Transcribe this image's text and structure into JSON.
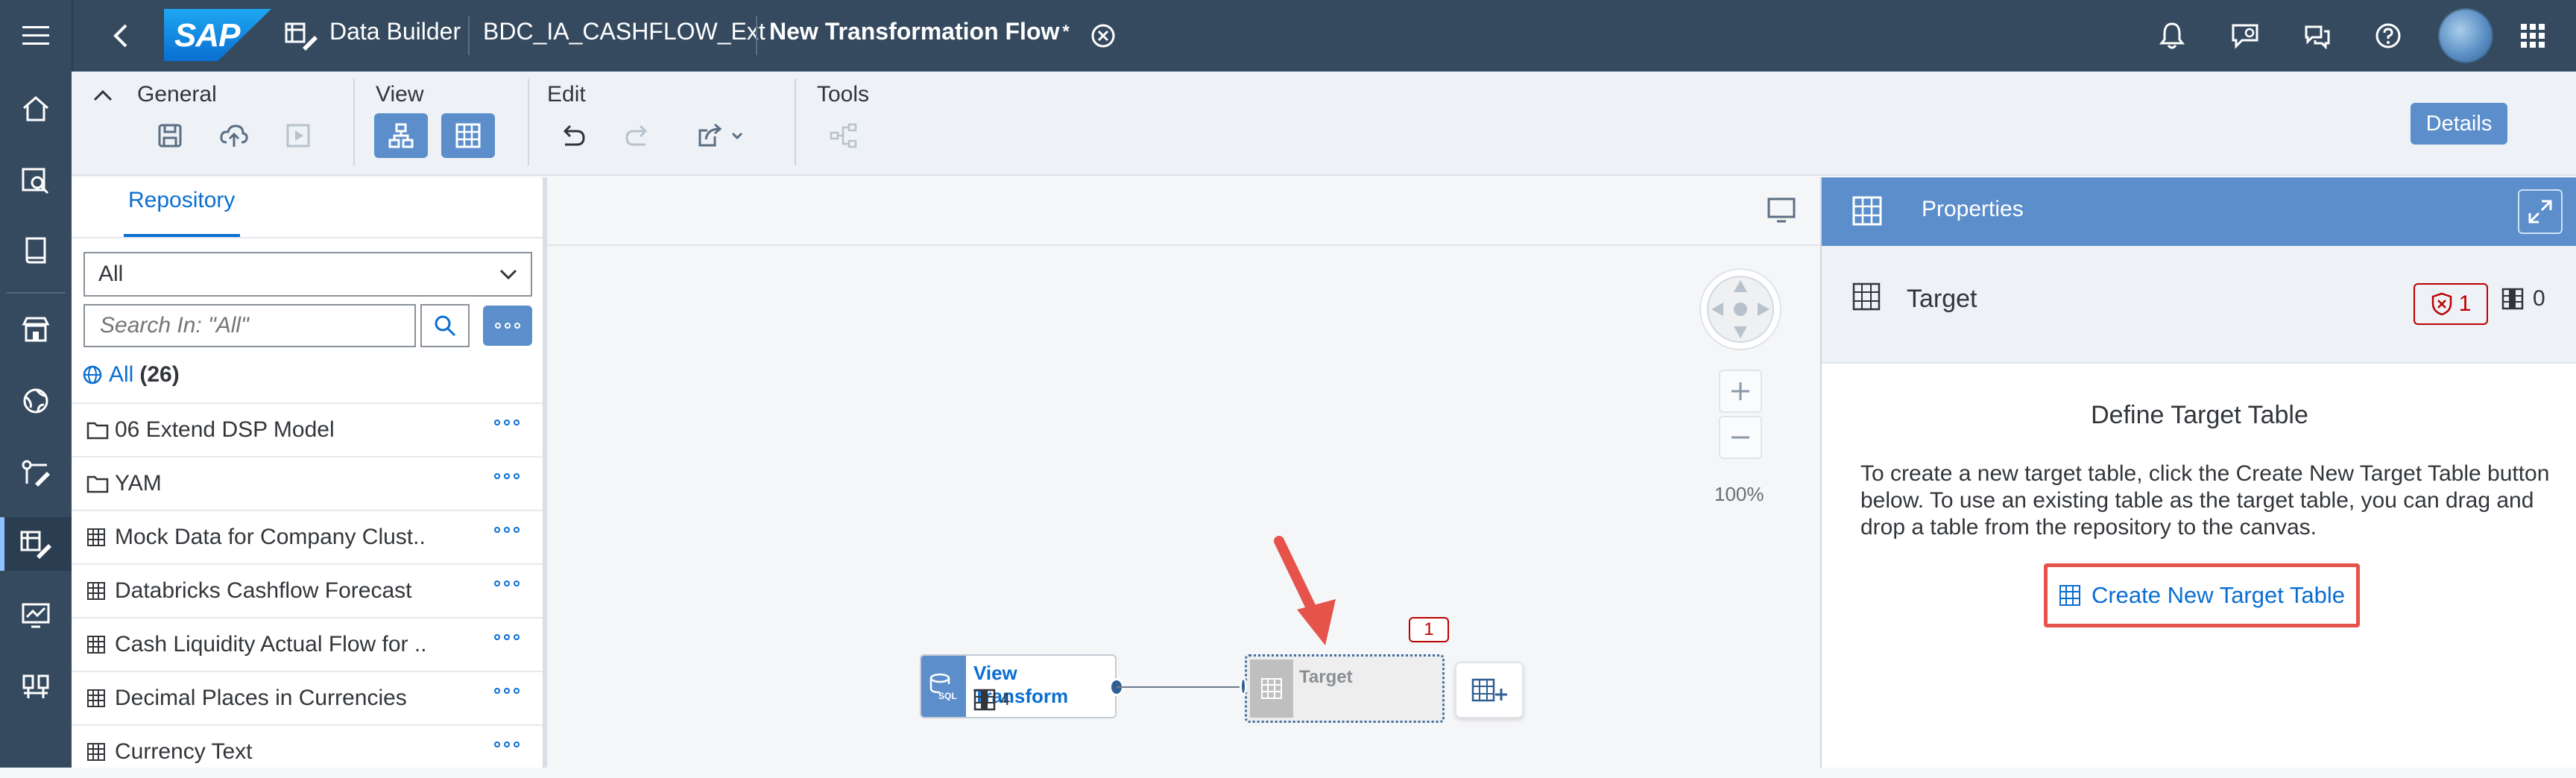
{
  "shell": {
    "logo": "SAP",
    "app_name": "Data Builder",
    "space_name": "BDC_IA_CASHFLOW_Ext",
    "flow_title": "New Transformation Flow",
    "modified_marker": "*"
  },
  "toolbar": {
    "general_label": "General",
    "view_label": "View",
    "edit_label": "Edit",
    "tools_label": "Tools",
    "details_label": "Details"
  },
  "repository": {
    "tab_label": "Repository",
    "select_value": "All",
    "search_placeholder": "Search In: \"All\"",
    "all_label": "All",
    "all_count": "(26)",
    "items": [
      {
        "label": "06 Extend DSP Model",
        "type": "folder"
      },
      {
        "label": "YAM",
        "type": "folder"
      },
      {
        "label": "Mock Data for Company Clust..",
        "type": "table"
      },
      {
        "label": "Databricks Cashflow Forecast",
        "type": "table"
      },
      {
        "label": "Cash Liquidity Actual Flow for ..",
        "type": "table"
      },
      {
        "label": "Decimal Places in Currencies",
        "type": "table"
      },
      {
        "label": "Currency Text",
        "type": "table"
      }
    ]
  },
  "canvas": {
    "zoom": "100%",
    "view_transform_node": {
      "title": "View Transform",
      "column_count": "4"
    },
    "target_node": {
      "title": "Target",
      "error_count": "1"
    }
  },
  "properties": {
    "header_title": "Properties",
    "object_name": "Target",
    "error_count": "1",
    "column_count": "0",
    "define_title": "Define Target Table",
    "define_text": "To create a new target table, click the Create New Target Table button below. To use an existing table as the target table, you can drag and drop a table from the repository to the canvas.",
    "create_button_label": "Create New Target Table"
  },
  "colors": {
    "shell": "#354a5f",
    "accent": "#5b8ecb",
    "link": "#0a6ed1",
    "error": "#bb0000",
    "highlight": "#e5534b"
  }
}
